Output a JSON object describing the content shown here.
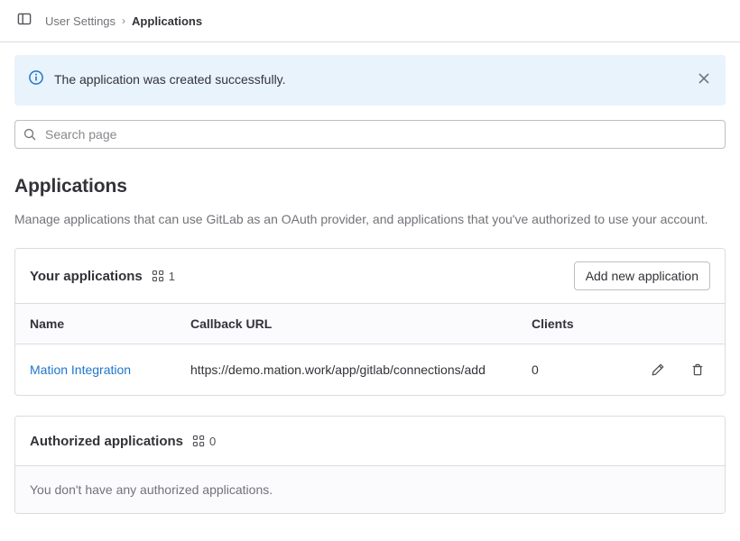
{
  "topbar": {
    "sidebar_toggle_icon": "sidebar-panel-icon",
    "breadcrumb": {
      "parent": "User Settings",
      "separator": "›",
      "current": "Applications"
    }
  },
  "alert": {
    "icon": "info-circle-icon",
    "message": "The application was created successfully.",
    "close_icon": "close-icon",
    "background_color": "#e9f3fc",
    "icon_color": "#1f75cb"
  },
  "search": {
    "icon": "search-icon",
    "placeholder": "Search page",
    "value": ""
  },
  "page": {
    "title": "Applications",
    "description": "Manage applications that can use GitLab as an OAuth provider, and applications that you've authorized to use your account."
  },
  "your_applications": {
    "title": "Your applications",
    "count_icon": "applications-grid-icon",
    "count": "1",
    "add_button_label": "Add new application",
    "columns": [
      "Name",
      "Callback URL",
      "Clients"
    ],
    "rows": [
      {
        "name": "Mation Integration",
        "callback_url": "https://demo.mation.work/app/gitlab/connections/add",
        "clients": "0",
        "edit_icon": "pencil-icon",
        "delete_icon": "trash-icon"
      }
    ],
    "link_color": "#1f75cb"
  },
  "authorized_applications": {
    "title": "Authorized applications",
    "count_icon": "applications-grid-icon",
    "count": "0",
    "empty_message": "You don't have any authorized applications."
  }
}
